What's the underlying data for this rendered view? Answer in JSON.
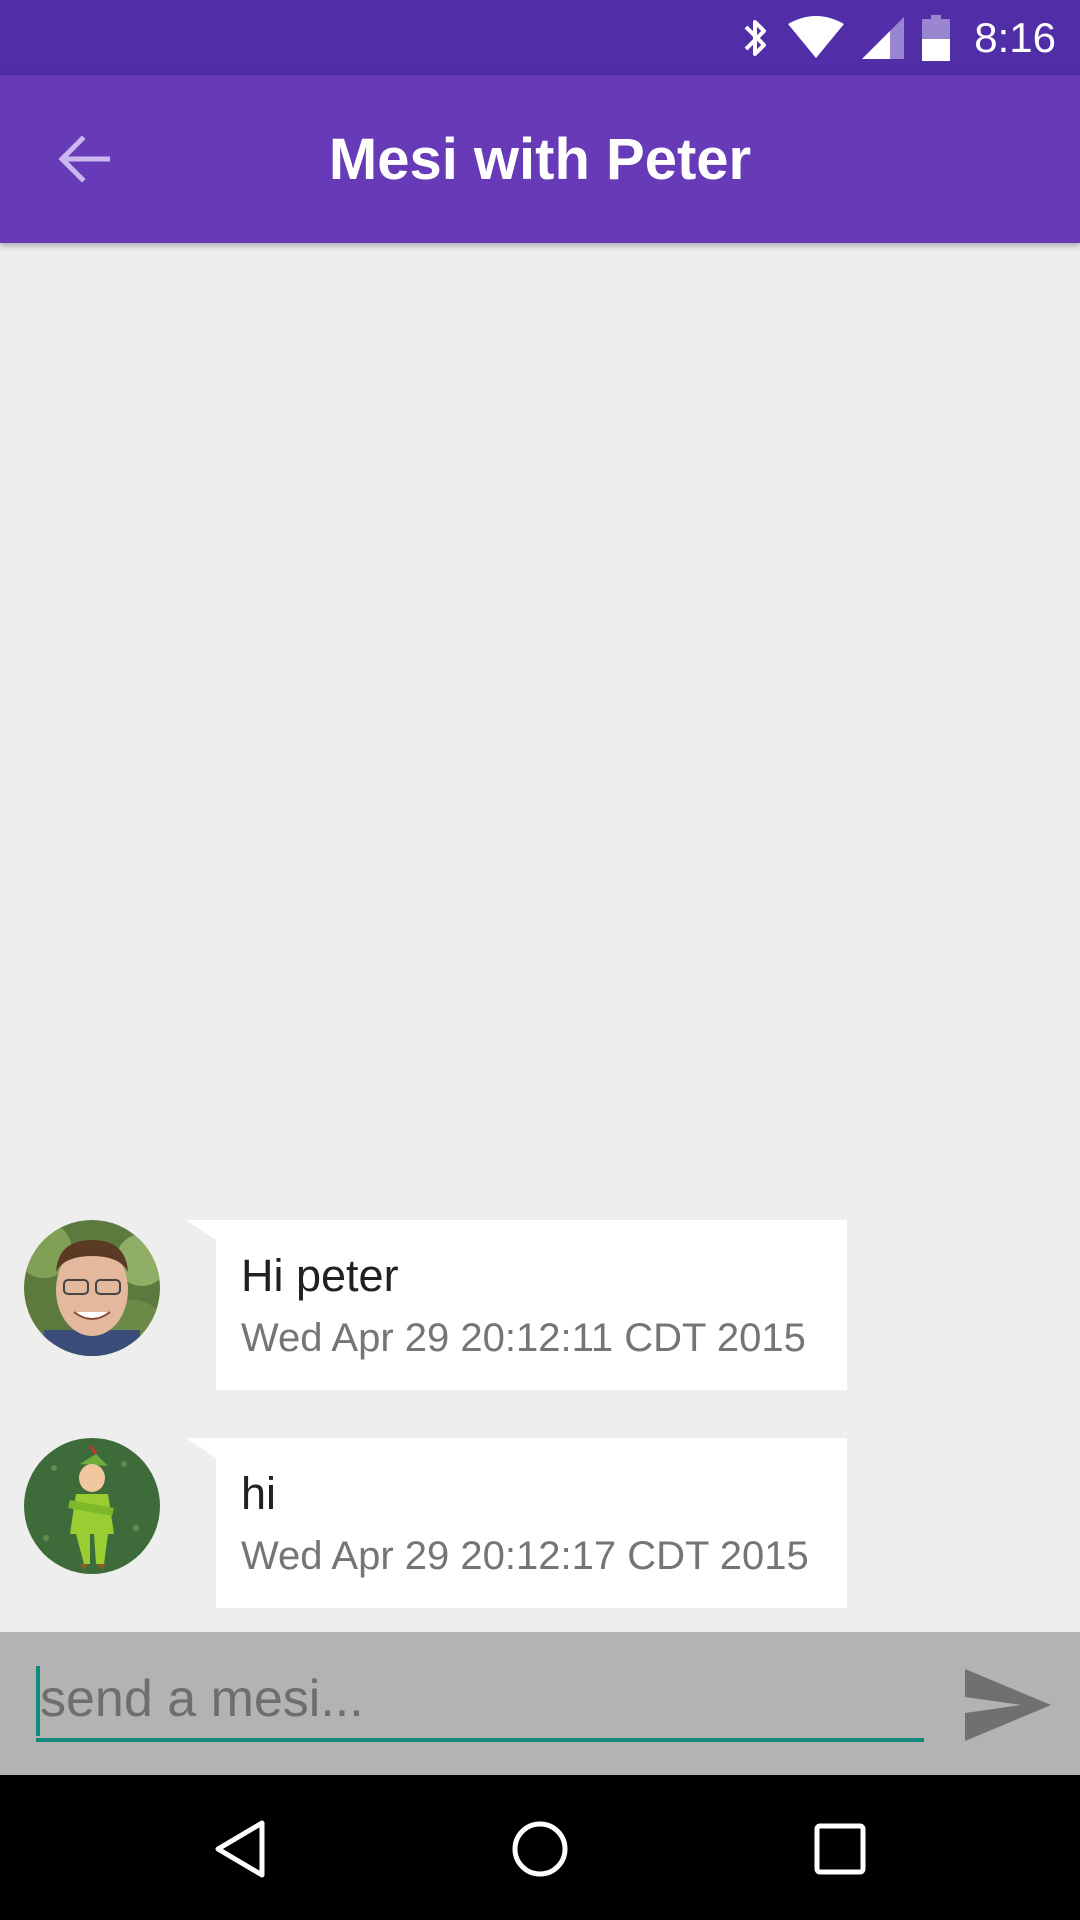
{
  "status_bar": {
    "time": "8:16",
    "icons": [
      "bluetooth-icon",
      "wifi-icon",
      "cell-signal-icon",
      "battery-icon"
    ]
  },
  "header": {
    "title": "Mesi with Peter",
    "back_icon": "arrow-back-icon"
  },
  "messages": [
    {
      "text": "Hi peter",
      "timestamp": "Wed Apr 29 20:12:11 CDT 2015",
      "avatar": "avatar-man-photo"
    },
    {
      "text": "hi",
      "timestamp": "Wed Apr 29 20:12:17 CDT 2015",
      "avatar": "avatar-peter-pan"
    }
  ],
  "composer": {
    "placeholder": "send a mesi...",
    "value": "",
    "send_icon": "send-icon"
  },
  "nav_bar": {
    "buttons": [
      "back-triangle-icon",
      "home-circle-icon",
      "recents-square-icon"
    ]
  },
  "colors": {
    "status_bar": "#512da8",
    "app_bar": "#673ab7",
    "background": "#eeeeee",
    "input_bar": "#b3b3b3",
    "input_accent": "#12897a"
  }
}
